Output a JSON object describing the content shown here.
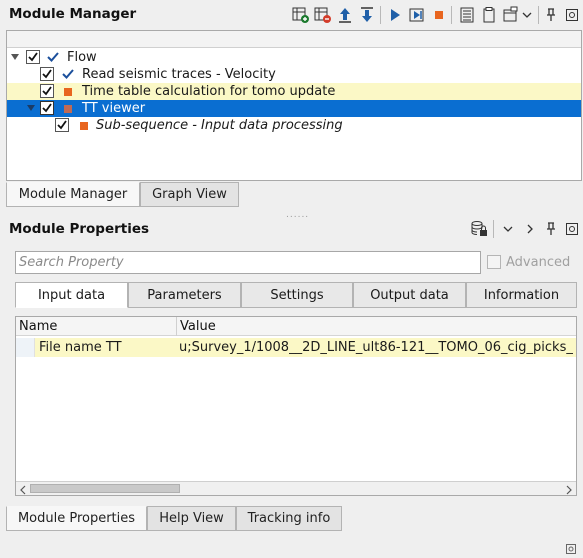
{
  "module_manager": {
    "title": "Module Manager",
    "tree": [
      {
        "label": "Flow",
        "checked": true,
        "state": "check",
        "italic": false,
        "highlight": "none"
      },
      {
        "label": "Read seismic traces - Velocity",
        "checked": true,
        "state": "check",
        "italic": false,
        "highlight": "none"
      },
      {
        "label": "Time table calculation for tomo update",
        "checked": true,
        "state": "square",
        "italic": false,
        "highlight": "yellow"
      },
      {
        "label": "TT viewer",
        "checked": true,
        "state": "square",
        "italic": false,
        "highlight": "selected"
      },
      {
        "label": "Sub-sequence - Input data processing",
        "checked": true,
        "state": "square",
        "italic": true,
        "highlight": "none"
      }
    ],
    "tabs": [
      "Module Manager",
      "Graph View"
    ]
  },
  "module_properties": {
    "title": "Module Properties",
    "search_placeholder": "Search Property",
    "advanced_label": "Advanced",
    "tabs": [
      "Input data",
      "Parameters",
      "Settings",
      "Output data",
      "Information"
    ],
    "table": {
      "columns": [
        "Name",
        "Value"
      ],
      "rows": [
        {
          "name": "File name TT",
          "value": "u;Survey_1/1008__2D_LINE_ult86-121__TOMO_06_cig_picks_"
        }
      ]
    },
    "bottom_tabs": [
      "Module Properties",
      "Help View",
      "Tracking info"
    ]
  },
  "colors": {
    "accent": "#0a6ed1",
    "highlight": "#fbf8c6",
    "status_orange": "#e8651f",
    "check_blue": "#1b4f9c"
  }
}
